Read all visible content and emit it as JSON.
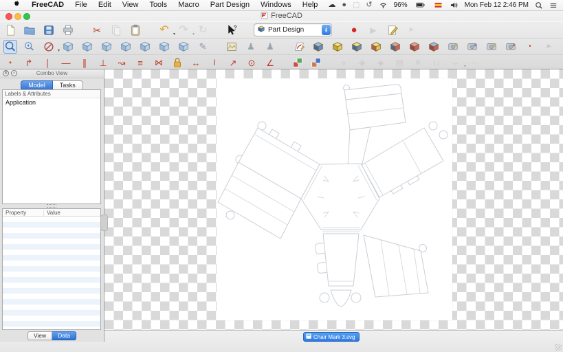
{
  "menubar": {
    "apple_menu": {
      "name": "apple-menu"
    },
    "items": [
      "FreeCAD",
      "File",
      "Edit",
      "View",
      "Tools",
      "Macro",
      "Part Design",
      "Windows",
      "Help"
    ],
    "status_items": [
      {
        "name": "cloud-icon",
        "kind": "glyph",
        "glyph": "☁",
        "color": "#333333"
      },
      {
        "name": "sync-icon",
        "kind": "glyph",
        "glyph": "●",
        "color": "#555555"
      },
      {
        "name": "inactive-icon",
        "kind": "glyph",
        "glyph": "▢",
        "color": "#c9c9c9"
      },
      {
        "name": "time-machine-icon",
        "kind": "glyph",
        "glyph": "↺",
        "color": "#555555"
      },
      {
        "name": "wifi-icon",
        "kind": "wifi"
      },
      {
        "name": "battery-percent",
        "kind": "text",
        "text": "96%"
      },
      {
        "name": "battery-icon",
        "kind": "battery"
      },
      {
        "name": "keyboard-flag-icon",
        "kind": "flag"
      },
      {
        "name": "volume-icon",
        "kind": "volume"
      },
      {
        "name": "clock",
        "kind": "text",
        "text": "Mon Feb 12 2:46 PM"
      },
      {
        "name": "spotlight-icon",
        "kind": "spotlight"
      },
      {
        "name": "notification-center-icon",
        "kind": "menulines"
      }
    ]
  },
  "window": {
    "title": "FreeCAD"
  },
  "workbench_select": {
    "value": "Part Design"
  },
  "toolbars": {
    "file": [
      {
        "name": "new-document",
        "kind": "page"
      },
      {
        "name": "open-folder",
        "kind": "folder"
      },
      {
        "name": "save",
        "kind": "disk"
      },
      {
        "name": "print",
        "kind": "printer"
      },
      {
        "kind": "sep"
      },
      {
        "name": "cut",
        "kind": "glyph",
        "glyph": "✂",
        "color": "#c0392b",
        "size": 14
      },
      {
        "name": "copy",
        "kind": "pages",
        "disabled": true
      },
      {
        "name": "paste",
        "kind": "clipboard"
      },
      {
        "kind": "sep"
      },
      {
        "name": "undo",
        "kind": "glyph",
        "glyph": "↶",
        "color": "#d9a62b",
        "size": 16,
        "dropdown": true
      },
      {
        "name": "redo",
        "kind": "glyph",
        "glyph": "↷",
        "color": "#8fbf8f",
        "size": 16,
        "dropdown": true,
        "disabled": true
      },
      {
        "name": "refresh",
        "kind": "glyph",
        "glyph": "↻",
        "color": "#9bb7d4",
        "size": 15,
        "disabled": true
      },
      {
        "kind": "sep"
      },
      {
        "name": "whats-this",
        "kind": "whatsthis"
      },
      {
        "kind": "sep"
      },
      {
        "name": "workbench-select",
        "kind": "select"
      },
      {
        "kind": "sep"
      },
      {
        "name": "macro-record",
        "kind": "glyph",
        "glyph": "●",
        "color": "#cf2a27",
        "size": 15
      },
      {
        "name": "macro-play",
        "kind": "glyph",
        "glyph": "▶",
        "color": "#8fbf8f",
        "size": 12,
        "disabled": true
      },
      {
        "name": "macro-edit",
        "kind": "editdoc"
      },
      {
        "name": "macro-step",
        "kind": "glyph",
        "glyph": "►",
        "color": "#9fc79f",
        "size": 11,
        "disabled": true
      }
    ],
    "view": [
      {
        "name": "fit-all",
        "kind": "magnifier",
        "active": true
      },
      {
        "name": "fit-selection",
        "kind": "magnifier2"
      },
      {
        "name": "draw-style",
        "kind": "slashcircle",
        "dropdown": true
      },
      {
        "name": "view-isometric",
        "kind": "cube"
      },
      {
        "name": "view-front",
        "kind": "cube"
      },
      {
        "name": "view-top",
        "kind": "cube"
      },
      {
        "name": "view-right",
        "kind": "cube"
      },
      {
        "name": "view-rear",
        "kind": "cube"
      },
      {
        "name": "view-bottom",
        "kind": "cube"
      },
      {
        "name": "view-left",
        "kind": "cube"
      },
      {
        "name": "measure-distance",
        "kind": "glyph",
        "glyph": "✎",
        "color": "#8b97a5",
        "size": 13
      },
      {
        "kind": "sep"
      },
      {
        "name": "image-plane",
        "kind": "photo"
      },
      {
        "name": "stereo-view-a",
        "kind": "glyph",
        "glyph": "♟",
        "color": "#9aa4ae",
        "size": 13
      },
      {
        "name": "stereo-view-b",
        "kind": "glyph",
        "glyph": "♟",
        "color": "#9aa4ae",
        "size": 13
      },
      {
        "kind": "sep"
      },
      {
        "name": "create-sketch",
        "kind": "sketchicon"
      },
      {
        "name": "map-sketch",
        "kind": "box",
        "t": "#9dbde8",
        "f": "#5e8fd0",
        "s": "#44699c"
      },
      {
        "name": "pad",
        "kind": "box",
        "t": "#f4e08a",
        "f": "#e8c84a",
        "s": "#c9a62e"
      },
      {
        "name": "pocket",
        "kind": "box",
        "t": "#f4e08a",
        "f": "#5e8fd0",
        "s": "#44699c"
      },
      {
        "name": "revolution",
        "kind": "box",
        "t": "#f4e08a",
        "f": "#e8c84a",
        "s": "#c0574f"
      },
      {
        "name": "groove",
        "kind": "box",
        "t": "#e89d9d",
        "f": "#d05e5e",
        "s": "#44699c"
      },
      {
        "name": "additive-primitive",
        "kind": "box",
        "t": "#e89d9d",
        "f": "#d05e5e",
        "s": "#9c4444"
      },
      {
        "name": "subtractive-primitive",
        "kind": "box",
        "t": "#9dbde8",
        "f": "#d05e5e",
        "s": "#9c4444"
      },
      {
        "name": "mirrored",
        "kind": "camera",
        "badge": "#e8c63f"
      },
      {
        "name": "linear-pattern",
        "kind": "camera",
        "badge": "#5a8fd8"
      },
      {
        "name": "polar-pattern",
        "kind": "camera",
        "badge": "#e8c63f"
      },
      {
        "name": "multi-transform",
        "kind": "camera",
        "badge": "#d05e5e"
      },
      {
        "name": "datum-point",
        "kind": "glyph",
        "glyph": "•",
        "color": "#c0392b",
        "size": 9
      },
      {
        "name": "toggle-freeze",
        "kind": "glyph",
        "glyph": "►",
        "color": "#c3cad1",
        "size": 10
      }
    ],
    "sketcher": [
      {
        "name": "create-point",
        "kind": "glyph",
        "glyph": "•",
        "color": "#d2691e",
        "size": 12
      },
      {
        "name": "create-polyline",
        "kind": "glyph",
        "glyph": "↱",
        "color": "#c0392b",
        "size": 13
      },
      {
        "name": "constrain-vertical",
        "kind": "glyph",
        "glyph": "∣",
        "color": "#c0392b",
        "size": 13
      },
      {
        "name": "constrain-horizontal",
        "kind": "glyph",
        "glyph": "—",
        "color": "#c0392b",
        "size": 13
      },
      {
        "name": "constrain-parallel",
        "kind": "glyph",
        "glyph": "∥",
        "color": "#c0392b",
        "size": 13
      },
      {
        "name": "constrain-perpendicular",
        "kind": "glyph",
        "glyph": "⊥",
        "color": "#c0392b",
        "size": 13
      },
      {
        "name": "constrain-tangent",
        "kind": "glyph",
        "glyph": "↝",
        "color": "#c0392b",
        "size": 13
      },
      {
        "name": "constrain-equal",
        "kind": "glyph",
        "glyph": "≡",
        "color": "#c0392b",
        "size": 13
      },
      {
        "name": "constrain-symmetric",
        "kind": "glyph",
        "glyph": "⋈",
        "color": "#c0392b",
        "size": 12
      },
      {
        "name": "constrain-lock",
        "kind": "lock"
      },
      {
        "name": "constrain-h-distance",
        "kind": "glyph",
        "glyph": "↔",
        "color": "#c0392b",
        "size": 13
      },
      {
        "name": "constrain-v-distance",
        "kind": "glyph",
        "glyph": "I",
        "color": "#c0392b",
        "size": 12
      },
      {
        "name": "constrain-distance",
        "kind": "glyph",
        "glyph": "↗",
        "color": "#c0392b",
        "size": 13
      },
      {
        "name": "constrain-radius",
        "kind": "glyph",
        "glyph": "⊙",
        "color": "#c0392b",
        "size": 13
      },
      {
        "name": "constrain-angle",
        "kind": "glyph",
        "glyph": "∠",
        "color": "#c0392b",
        "size": 13
      },
      {
        "kind": "sep"
      },
      {
        "name": "toggle-driving-constraint",
        "kind": "dualbox",
        "a": "#cc4b4b",
        "b": "#58a858"
      },
      {
        "name": "toggle-construction",
        "kind": "dualbox",
        "a": "#cc7a4b",
        "b": "#4b74cc"
      },
      {
        "kind": "sep"
      },
      {
        "name": "select-origin",
        "kind": "glyph",
        "glyph": "⌖",
        "color": "#aab4be",
        "size": 13,
        "disabled": true
      },
      {
        "name": "select-constraints",
        "kind": "glyph",
        "glyph": "◈",
        "color": "#aab4be",
        "size": 12,
        "disabled": true
      },
      {
        "name": "select-conflicting",
        "kind": "glyph",
        "glyph": "◈",
        "color": "#d8a0b0",
        "size": 12,
        "disabled": true
      },
      {
        "name": "select-elements",
        "kind": "glyph",
        "glyph": "▤",
        "color": "#c9b89a",
        "size": 12,
        "disabled": true
      },
      {
        "name": "delete-geometry",
        "kind": "glyph",
        "glyph": "✕",
        "color": "#9fb0c4",
        "size": 12,
        "disabled": true
      },
      {
        "name": "clone-geometry",
        "kind": "glyph",
        "glyph": "( )",
        "color": "#a9b2bc",
        "size": 9,
        "disabled": true
      },
      {
        "name": "extend-edge",
        "kind": "glyph",
        "glyph": "⌣",
        "color": "#a9b2bc",
        "size": 13,
        "disabled": true,
        "dropdown": true
      },
      {
        "name": "insert-knot",
        "kind": "glyph",
        "glyph": "∴",
        "color": "#a9b2bc",
        "size": 11,
        "disabled": true
      }
    ]
  },
  "combo_view": {
    "title": "Combo View",
    "tabs": [
      {
        "label": "Model",
        "active": true
      },
      {
        "label": "Tasks",
        "active": false
      }
    ],
    "tree": {
      "header": "Labels & Attributes",
      "items": [
        "Application"
      ]
    },
    "property_table": {
      "columns": [
        "Property",
        "Value"
      ],
      "rows": []
    },
    "bottom_tabs": [
      {
        "label": "View",
        "active": false
      },
      {
        "label": "Data",
        "active": true
      }
    ]
  },
  "document_tab": {
    "label": "Chair Mark 3.svg"
  },
  "colors": {
    "accent_blue": "#2e7ae2",
    "selection_blue": "#3572cf",
    "checker_gray": "#d9d9d9",
    "constraint_red": "#c0392b",
    "net_line": "#c9ced6"
  }
}
